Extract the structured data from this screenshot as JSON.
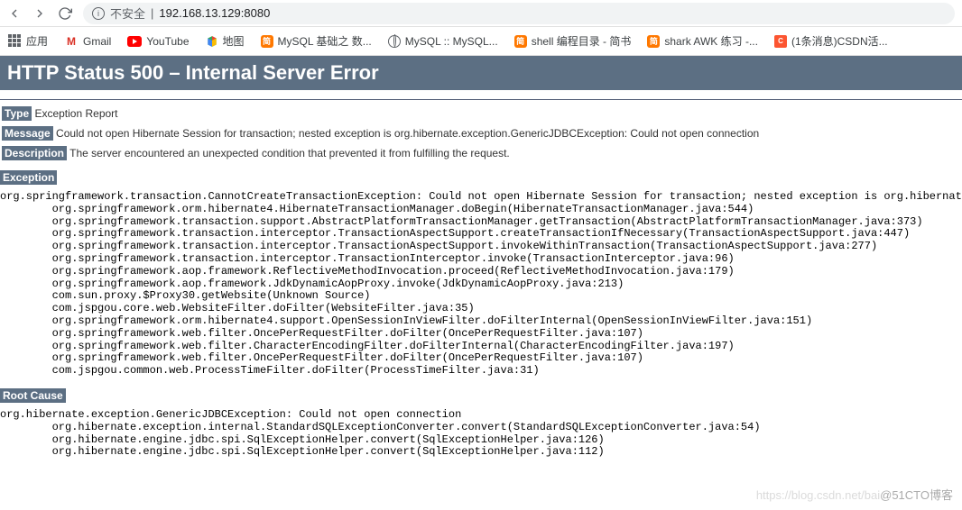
{
  "browser": {
    "security_label": "不安全",
    "url": "192.168.13.129:8080"
  },
  "bookmarks": {
    "apps_label": "应用",
    "gmail_label": "Gmail",
    "youtube_label": "YouTube",
    "maps_label": "地图",
    "mysql_basics_label": "MySQL 基础之 数...",
    "mysql_label": "MySQL :: MySQL...",
    "shell_label": "shell 编程目录 - 简书",
    "shark_label": "shark AWK 练习 -...",
    "csdn_label": "(1条消息)CSDN活..."
  },
  "error": {
    "header": "HTTP Status 500 – Internal Server Error",
    "type_label": "Type",
    "type_value": " Exception Report",
    "message_label": "Message",
    "message_value": " Could not open Hibernate Session for transaction; nested exception is org.hibernate.exception.GenericJDBCException: Could not open connection",
    "description_label": "Description",
    "description_value": " The server encountered an unexpected condition that prevented it from fulfilling the request.",
    "exception_label": "Exception",
    "exception_trace": "org.springframework.transaction.CannotCreateTransactionException: Could not open Hibernate Session for transaction; nested exception is org.hibernate.ex\n\torg.springframework.orm.hibernate4.HibernateTransactionManager.doBegin(HibernateTransactionManager.java:544)\n\torg.springframework.transaction.support.AbstractPlatformTransactionManager.getTransaction(AbstractPlatformTransactionManager.java:373)\n\torg.springframework.transaction.interceptor.TransactionAspectSupport.createTransactionIfNecessary(TransactionAspectSupport.java:447)\n\torg.springframework.transaction.interceptor.TransactionAspectSupport.invokeWithinTransaction(TransactionAspectSupport.java:277)\n\torg.springframework.transaction.interceptor.TransactionInterceptor.invoke(TransactionInterceptor.java:96)\n\torg.springframework.aop.framework.ReflectiveMethodInvocation.proceed(ReflectiveMethodInvocation.java:179)\n\torg.springframework.aop.framework.JdkDynamicAopProxy.invoke(JdkDynamicAopProxy.java:213)\n\tcom.sun.proxy.$Proxy30.getWebsite(Unknown Source)\n\tcom.jspgou.core.web.WebsiteFilter.doFilter(WebsiteFilter.java:35)\n\torg.springframework.orm.hibernate4.support.OpenSessionInViewFilter.doFilterInternal(OpenSessionInViewFilter.java:151)\n\torg.springframework.web.filter.OncePerRequestFilter.doFilter(OncePerRequestFilter.java:107)\n\torg.springframework.web.filter.CharacterEncodingFilter.doFilterInternal(CharacterEncodingFilter.java:197)\n\torg.springframework.web.filter.OncePerRequestFilter.doFilter(OncePerRequestFilter.java:107)\n\tcom.jspgou.common.web.ProcessTimeFilter.doFilter(ProcessTimeFilter.java:31)",
    "root_cause_label": "Root Cause",
    "root_cause_trace": "org.hibernate.exception.GenericJDBCException: Could not open connection\n\torg.hibernate.exception.internal.StandardSQLExceptionConverter.convert(StandardSQLExceptionConverter.java:54)\n\torg.hibernate.engine.jdbc.spi.SqlExceptionHelper.convert(SqlExceptionHelper.java:126)\n\torg.hibernate.engine.jdbc.spi.SqlExceptionHelper.convert(SqlExceptionHelper.java:112)"
  },
  "watermark": {
    "faded": "https://blog.csdn.net/bai",
    "text": "@51CTO博客"
  }
}
